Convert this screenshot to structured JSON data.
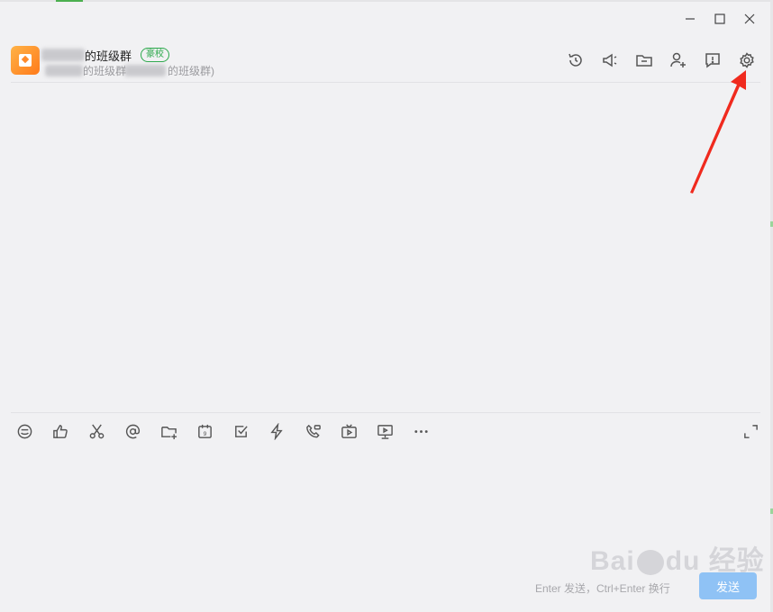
{
  "window": {
    "minimize_icon": "minimize-icon",
    "maximize_icon": "maximize-icon",
    "close_icon": "close-icon"
  },
  "header": {
    "group_name": "的班级群",
    "badge": "豪校",
    "subtitle_part1": "的班级群",
    "subtitle_part2": "的班级群)",
    "icons": [
      "history-icon",
      "announcement-icon",
      "folder-icon",
      "add-member-icon",
      "message-board-icon",
      "settings-icon"
    ]
  },
  "toolbar": {
    "icons": [
      "emoji-icon",
      "like-icon",
      "scissors-icon",
      "mention-icon",
      "folder-plus-icon",
      "calendar-icon",
      "checkbox-icon",
      "lightning-icon",
      "phone-icon",
      "tv-icon",
      "presentation-icon",
      "more-icon"
    ],
    "expand_icon": "expand-icon"
  },
  "footer": {
    "hint": "Enter 发送，Ctrl+Enter 换行",
    "send_label": "发送"
  },
  "watermark": {
    "text_left": "Bai",
    "text_mid": "du",
    "text_right": "经验"
  },
  "colors": {
    "accent": "#2aa84a",
    "send_button": "#8fc2f5",
    "arrow": "#f02a1e"
  }
}
